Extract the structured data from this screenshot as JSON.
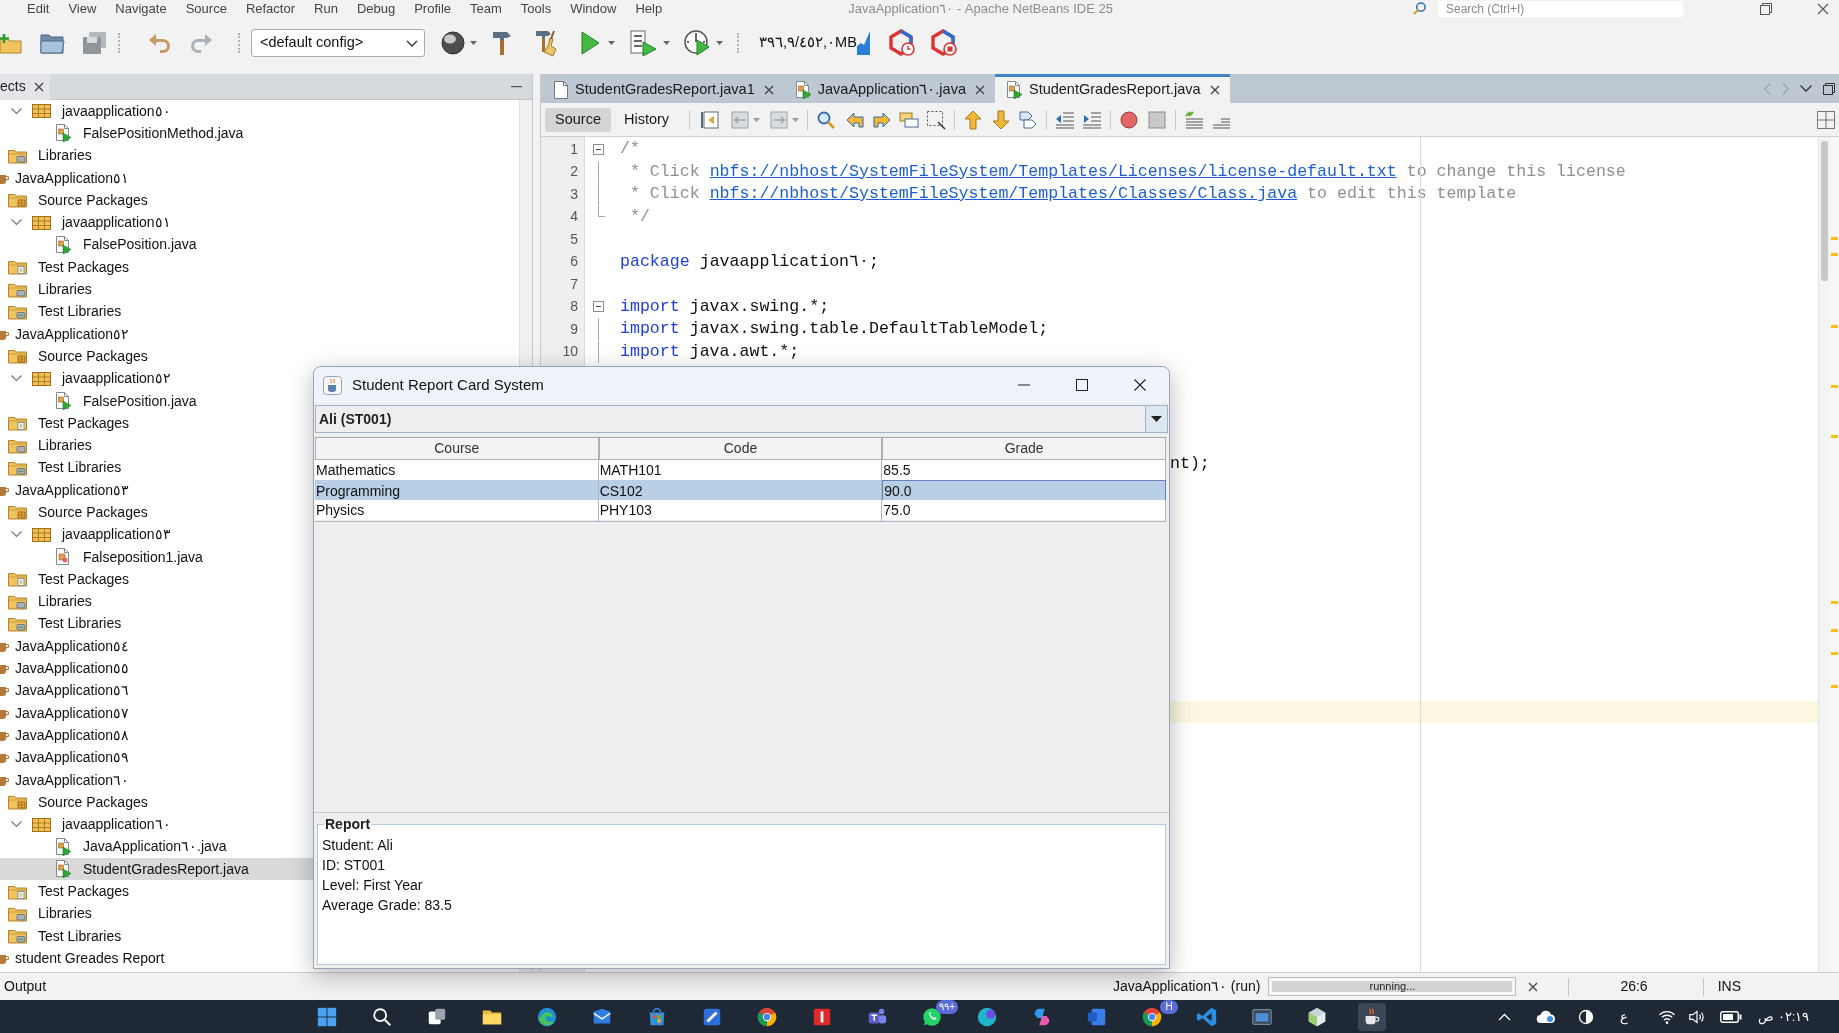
{
  "menu_bar": {
    "items": [
      "Edit",
      "View",
      "Navigate",
      "Source",
      "Refactor",
      "Run",
      "Debug",
      "Profile",
      "Team",
      "Tools",
      "Window",
      "Help"
    ]
  },
  "window": {
    "title": "JavaApplication٦٠ - Apache NetBeans IDE 25"
  },
  "search": {
    "placeholder": "Search (Ctrl+I)"
  },
  "toolbar": {
    "config": "<default config>",
    "memory": "٣٩٦,٩/٤٥٢,٠MB"
  },
  "projects_panel": {
    "tab": "ects",
    "tree": [
      {
        "children": [
          {
            "children": [
              {
                "kind": "package",
                "label": "javaapplication٥٠",
                "expanded": true,
                "selected": false,
                "children": [
                  {
                    "kind": "java",
                    "label": "FalsePositionMethod.java",
                    "selected": false
                  }
                ]
              }
            ]
          },
          {
            "kind": "libraries",
            "label": "Libraries",
            "selected": false
          }
        ]
      },
      {
        "kind": "project",
        "label": "JavaApplication٥١",
        "selected": false,
        "children": [
          {
            "kind": "source_root",
            "label": "Source Packages",
            "selected": false,
            "children": [
              {
                "kind": "package",
                "label": "javaapplication٥١",
                "expanded": true,
                "selected": false,
                "children": [
                  {
                    "kind": "java",
                    "label": "FalsePosition.java",
                    "selected": false
                  }
                ]
              }
            ]
          },
          {
            "kind": "test_root",
            "label": "Test Packages",
            "selected": false
          },
          {
            "kind": "libraries",
            "label": "Libraries",
            "selected": false
          },
          {
            "kind": "test_libraries",
            "label": "Test Libraries",
            "selected": false
          }
        ]
      },
      {
        "kind": "project",
        "label": "JavaApplication٥٢",
        "selected": false,
        "children": [
          {
            "kind": "source_root",
            "label": "Source Packages",
            "selected": false,
            "children": [
              {
                "kind": "package",
                "label": "javaapplication٥٢",
                "expanded": true,
                "selected": false,
                "children": [
                  {
                    "kind": "java",
                    "label": "FalsePosition.java",
                    "selected": false
                  }
                ]
              }
            ]
          },
          {
            "kind": "test_root",
            "label": "Test Packages",
            "selected": false
          },
          {
            "kind": "libraries",
            "label": "Libraries",
            "selected": false
          },
          {
            "kind": "test_libraries",
            "label": "Test Libraries",
            "selected": false
          }
        ]
      },
      {
        "kind": "project",
        "label": "JavaApplication٥٣",
        "selected": false,
        "children": [
          {
            "kind": "source_root",
            "label": "Source Packages",
            "selected": false,
            "children": [
              {
                "kind": "package",
                "label": "javaapplication٥٣",
                "expanded": true,
                "selected": false,
                "children": [
                  {
                    "kind": "class",
                    "label": "Falseposition1.java",
                    "selected": false
                  }
                ]
              }
            ]
          },
          {
            "kind": "test_root",
            "label": "Test Packages",
            "selected": false
          },
          {
            "kind": "libraries",
            "label": "Libraries",
            "selected": false
          },
          {
            "kind": "test_libraries",
            "label": "Test Libraries",
            "selected": false
          }
        ]
      },
      {
        "kind": "project",
        "label": "JavaApplication٥٤",
        "selected": false
      },
      {
        "kind": "project",
        "label": "JavaApplication٥٥",
        "selected": false
      },
      {
        "kind": "project",
        "label": "JavaApplication٥٦",
        "selected": false
      },
      {
        "kind": "project",
        "label": "JavaApplication٥٧",
        "selected": false
      },
      {
        "kind": "project",
        "label": "JavaApplication٥٨",
        "selected": false
      },
      {
        "kind": "project",
        "label": "JavaApplication٥٩",
        "selected": false
      },
      {
        "kind": "project",
        "label": "JavaApplication٦٠",
        "selected": false,
        "children": [
          {
            "kind": "source_root",
            "label": "Source Packages",
            "selected": false,
            "children": [
              {
                "kind": "package",
                "label": "javaapplication٦٠",
                "expanded": true,
                "selected": false,
                "children": [
                  {
                    "kind": "java",
                    "label": "JavaApplication٦٠.java",
                    "selected": false
                  },
                  {
                    "kind": "java",
                    "label": "StudentGradesReport.java",
                    "selected": true
                  }
                ]
              }
            ]
          },
          {
            "kind": "test_root",
            "label": "Test Packages",
            "selected": false
          },
          {
            "kind": "libraries",
            "label": "Libraries",
            "selected": false
          },
          {
            "kind": "test_libraries",
            "label": "Test Libraries",
            "selected": false
          }
        ]
      },
      {
        "kind": "project",
        "label": "student Greades Report",
        "selected": false
      }
    ]
  },
  "editor": {
    "tabs": [
      {
        "label": "StudentGradesReport.java1",
        "kind": "file",
        "selected": false
      },
      {
        "label": "JavaApplication٦٠.java",
        "kind": "java",
        "selected": false
      },
      {
        "label": "StudentGradesReport.java",
        "kind": "java",
        "selected": true
      }
    ],
    "views": [
      {
        "label": "Source",
        "selected": true
      },
      {
        "label": "History",
        "selected": false
      }
    ],
    "lines": [
      {
        "number": "1",
        "kind": "fold_start",
        "tokens": [
          {
            "kind": "comment",
            "text": "/*"
          }
        ]
      },
      {
        "number": "2",
        "kind": "fold_inner",
        "tokens": [
          {
            "kind": "comment",
            "text": " * Click "
          },
          {
            "kind": "link",
            "text": "nbfs://nbhost/SystemFileSystem/Templates/Licenses/license-default.txt"
          },
          {
            "kind": "comment",
            "text": " to change this license"
          }
        ]
      },
      {
        "number": "3",
        "kind": "fold_inner",
        "tokens": [
          {
            "kind": "comment",
            "text": " * Click "
          },
          {
            "kind": "link",
            "text": "nbfs://nbhost/SystemFileSystem/Templates/Classes/Class.java"
          },
          {
            "kind": "comment",
            "text": " to edit this template"
          }
        ]
      },
      {
        "number": "4",
        "kind": "fold_end",
        "tokens": [
          {
            "kind": "comment",
            "text": " */"
          }
        ]
      },
      {
        "number": "5",
        "kind": "plain"
      },
      {
        "number": "6",
        "kind": "plain",
        "tokens": [
          {
            "kind": "keyword",
            "text": "package"
          },
          {
            "kind": "plain",
            "text": " javaapplication٦٠;"
          }
        ]
      },
      {
        "number": "7",
        "kind": "plain"
      },
      {
        "number": "8",
        "kind": "fold_start",
        "tokens": [
          {
            "kind": "keyword",
            "text": "import"
          },
          {
            "kind": "plain",
            "text": " javax.swing.*;"
          }
        ]
      },
      {
        "number": "9",
        "kind": "fold_inner",
        "tokens": [
          {
            "kind": "keyword",
            "text": "import"
          },
          {
            "kind": "plain",
            "text": " javax.swing.table.DefaultTableModel;"
          }
        ]
      },
      {
        "number": "10",
        "kind": "fold_inner",
        "tokens": [
          {
            "kind": "keyword",
            "text": "import"
          },
          {
            "kind": "plain",
            "text": " java.awt.*;"
          }
        ]
      }
    ],
    "covered_fragment": "nt);"
  },
  "dialog": {
    "title": "Student Report Card System",
    "student": "Ali (ST001)",
    "table": {
      "columns": [
        "Course",
        "Code",
        "Grade"
      ],
      "rows": [
        {
          "cells": [
            "Mathematics",
            "MATH101",
            "85.5"
          ],
          "selected": false
        },
        {
          "cells": [
            "Programming",
            "CS102",
            "90.0"
          ],
          "selected": true
        },
        {
          "cells": [
            "Physics",
            "PHY103",
            "75.0"
          ],
          "selected": false
        }
      ]
    },
    "report": {
      "title": "Report",
      "lines": [
        "Student: Ali",
        "ID: ST001",
        "Level: First Year",
        "Average Grade: 83.5"
      ]
    }
  },
  "status_bar": {
    "output": "Output",
    "task": "JavaApplication٦٠ (run)",
    "progress": {
      "label": "running...",
      "level": 1
    },
    "position": "26:6",
    "mode": "INS"
  },
  "taskbar": {
    "apps": [
      {
        "kind": "start",
        "active": false
      },
      {
        "kind": "search",
        "active": false
      },
      {
        "kind": "task_view",
        "active": false
      },
      {
        "kind": "folder",
        "active": false
      },
      {
        "kind": "swirl",
        "active": false
      },
      {
        "kind": "mail",
        "active": false
      },
      {
        "kind": "store",
        "active": false
      },
      {
        "kind": "slash_tile",
        "active": false
      },
      {
        "kind": "chrome",
        "active": false
      },
      {
        "kind": "bar_tile",
        "active": false
      },
      {
        "kind": "people",
        "active": false
      },
      {
        "kind": "chat",
        "active": false,
        "badge": "٩٩+"
      },
      {
        "kind": "circle",
        "active": false
      },
      {
        "kind": "copilot",
        "active": false
      },
      {
        "kind": "doc",
        "active": false
      },
      {
        "kind": "chrome",
        "active": false,
        "badge": "H"
      },
      {
        "kind": "code",
        "active": false
      },
      {
        "kind": "window",
        "active": false
      },
      {
        "kind": "cube",
        "active": false
      },
      {
        "kind": "java",
        "active": true
      }
    ],
    "tray": {
      "language": "ع",
      "time": "٠٢:١٩ ص"
    }
  }
}
